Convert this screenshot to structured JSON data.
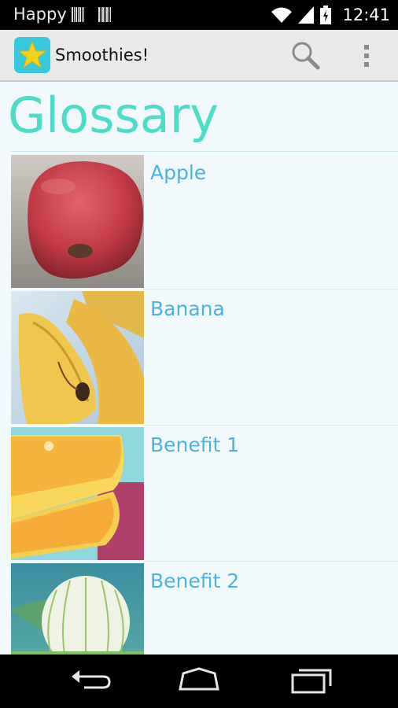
{
  "status_bar": {
    "carrier": "Happy",
    "time": "12:41"
  },
  "action_bar": {
    "app_title": "Smoothies!",
    "app_icon": "star-icon",
    "search_icon": "search-icon",
    "overflow_icon": "overflow-menu-icon"
  },
  "page": {
    "title": "Glossary"
  },
  "glossary": {
    "items": [
      {
        "label": "Apple",
        "image": "apple-image"
      },
      {
        "label": "Banana",
        "image": "banana-image"
      },
      {
        "label": "Benefit 1",
        "image": "grapefruit-image"
      },
      {
        "label": "Benefit 2",
        "image": "fennel-image"
      }
    ]
  },
  "nav_bar": {
    "back_icon": "back-icon",
    "home_icon": "home-icon",
    "recents_icon": "recents-icon"
  }
}
